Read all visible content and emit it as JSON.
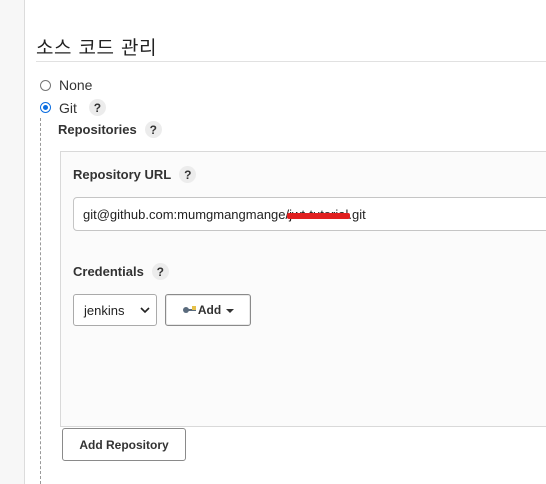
{
  "section": {
    "title": "소스 코드 관리"
  },
  "scm": {
    "options": [
      {
        "label": "None",
        "selected": false
      },
      {
        "label": "Git",
        "selected": true
      }
    ],
    "help": "?"
  },
  "repositories": {
    "label": "Repositories",
    "url_label": "Repository URL",
    "url_value_prefix": "git@github.com:mumgmangmange/",
    "url_value_redacted": "jwt-tutorial",
    "url_value_suffix": ".git",
    "credentials_label": "Credentials",
    "credentials_selected": "jenkins",
    "add_label": "Add",
    "add_repository_label": "Add Repository"
  },
  "icons": {
    "key": "key-icon",
    "help": "help-icon"
  },
  "colors": {
    "accent": "#0b6de0",
    "redaction": "#e02020"
  }
}
